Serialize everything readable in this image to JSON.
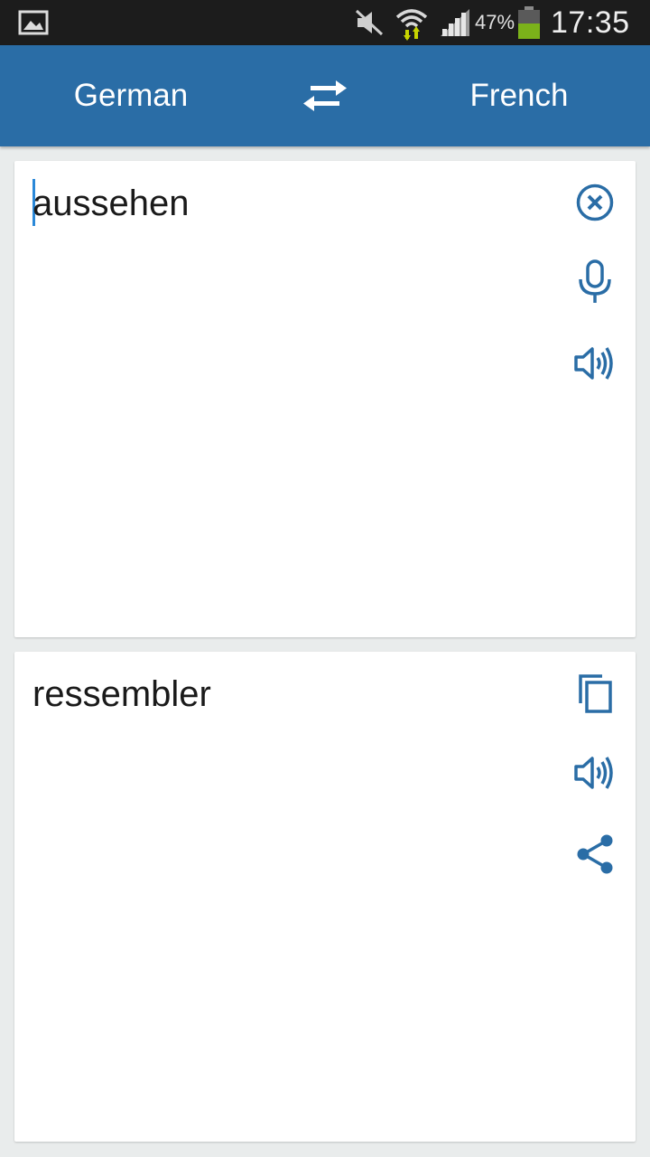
{
  "status_bar": {
    "battery_percent": "47%",
    "time": "17:35",
    "icons": [
      "image-icon",
      "mute-icon",
      "wifi-icon",
      "signal-icon",
      "battery-icon"
    ]
  },
  "header": {
    "source_language": "German",
    "target_language": "French",
    "swap_icon": "swap-icon"
  },
  "input_card": {
    "text": "aussehen",
    "actions": [
      "clear-icon",
      "microphone-icon",
      "speaker-icon"
    ]
  },
  "output_card": {
    "text": "ressembler",
    "actions": [
      "copy-icon",
      "speaker-icon",
      "share-icon"
    ]
  },
  "colors": {
    "app_bar": "#2a6da6",
    "accent_icon": "#2a6da6",
    "background": "#e9ecec",
    "status_bar": "#1c1c1c"
  }
}
